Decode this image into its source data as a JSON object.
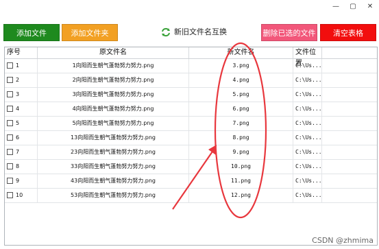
{
  "window": {
    "controls": [
      {
        "name": "minimize",
        "glyph": "—"
      },
      {
        "name": "maximize",
        "glyph": "▢"
      },
      {
        "name": "close",
        "glyph": "✕"
      }
    ]
  },
  "toolbar": {
    "add_file": "添加文件",
    "add_folder": "添加文件夹",
    "swap_names": "新旧文件名互换",
    "delete_selected": "删除已选的文件",
    "clear_table": "清空表格",
    "colors": {
      "add_file": "#1e8a1e",
      "add_folder": "#f2a023",
      "delete_selected": "#f2577a",
      "clear_table": "#f20e0e"
    },
    "swap_icon": "refresh-icon"
  },
  "table": {
    "headers": [
      "序号",
      "原文件名",
      "新文件名",
      "文件位置"
    ],
    "rows": [
      {
        "index": "1",
        "original": "1向阳而生朝气蓬勃努力努力.png",
        "new": "3.png",
        "location": "C:\\Us..."
      },
      {
        "index": "2",
        "original": "2向阳而生朝气蓬勃努力努力.png",
        "new": "4.png",
        "location": "C:\\Us..."
      },
      {
        "index": "3",
        "original": "3向阳而生朝气蓬勃努力努力.png",
        "new": "5.png",
        "location": "C:\\Us..."
      },
      {
        "index": "4",
        "original": "4向阳而生朝气蓬勃努力努力.png",
        "new": "6.png",
        "location": "C:\\Us..."
      },
      {
        "index": "5",
        "original": "5向阳而生朝气蓬勃努力努力.png",
        "new": "7.png",
        "location": "C:\\Us..."
      },
      {
        "index": "6",
        "original": "13向阳而生朝气蓬勃努力努力.png",
        "new": "8.png",
        "location": "C:\\Us..."
      },
      {
        "index": "7",
        "original": "23向阳而生朝气蓬勃努力努力.png",
        "new": "9.png",
        "location": "C:\\Us..."
      },
      {
        "index": "8",
        "original": "33向阳而生朝气蓬勃努力努力.png",
        "new": "10.png",
        "location": "C:\\Us..."
      },
      {
        "index": "9",
        "original": "43向阳而生朝气蓬勃努力努力.png",
        "new": "11.png",
        "location": "C:\\Us..."
      },
      {
        "index": "10",
        "original": "53向阳而生朝气蓬勃努力努力.png",
        "new": "12.png",
        "location": "C:\\Us..."
      }
    ]
  },
  "annotation": {
    "color": "#e8373d"
  },
  "watermark": "CSDN @zhmima"
}
